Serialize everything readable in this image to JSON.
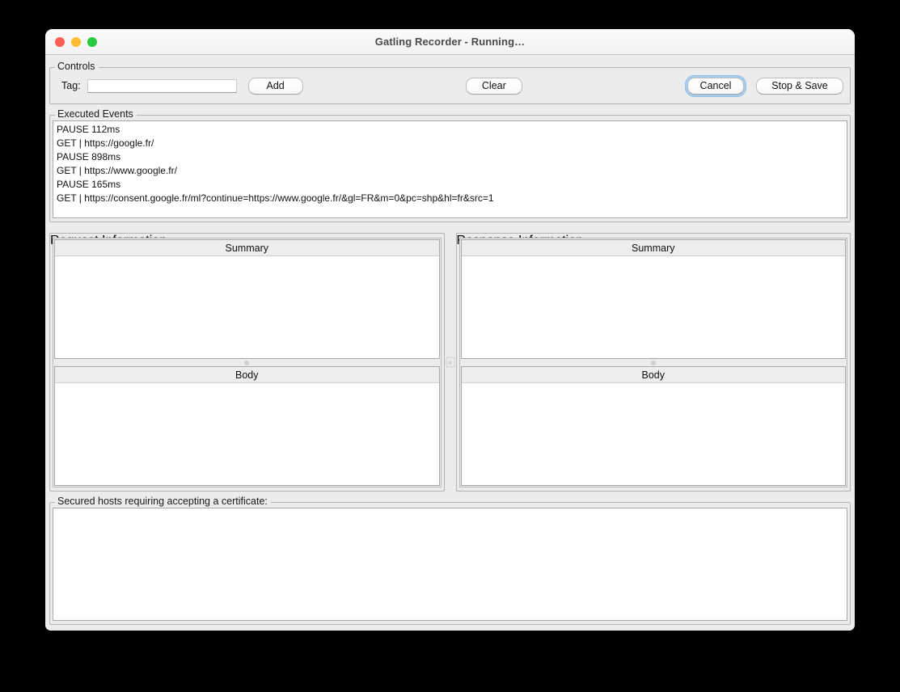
{
  "window": {
    "title": "Gatling Recorder - Running…",
    "traffic_lights": [
      {
        "name": "close",
        "color": "#ff5f57"
      },
      {
        "name": "minimize",
        "color": "#febc2e"
      },
      {
        "name": "maximize",
        "color": "#28c840"
      }
    ]
  },
  "controls": {
    "group_title": "Controls",
    "tag_label": "Tag:",
    "tag_value": "",
    "tag_placeholder": "",
    "add_label": "Add",
    "clear_label": "Clear",
    "cancel_label": "Cancel",
    "stop_save_label": "Stop & Save"
  },
  "executed_events": {
    "group_title": "Executed Events",
    "lines": [
      "PAUSE 112ms",
      "GET | https://google.fr/",
      "PAUSE 898ms",
      "GET | https://www.google.fr/",
      "PAUSE 165ms",
      "GET | https://consent.google.fr/ml?continue=https://www.google.fr/&gl=FR&m=0&pc=shp&hl=fr&src=1"
    ]
  },
  "request_information": {
    "group_title": "Request Information",
    "summary_label": "Summary",
    "summary_content": "",
    "body_label": "Body",
    "body_content": ""
  },
  "response_information": {
    "group_title": "Response Information",
    "summary_label": "Summary",
    "summary_content": "",
    "body_label": "Body",
    "body_content": ""
  },
  "secured_hosts": {
    "group_title": "Secured hosts requiring accepting a certificate:",
    "content": ""
  },
  "colors": {
    "window_background": "#ececec",
    "panel_background": "#ffffff",
    "border": "#b3b3b3",
    "focus_ring": "#a8cdee",
    "desktop": "#000000"
  }
}
